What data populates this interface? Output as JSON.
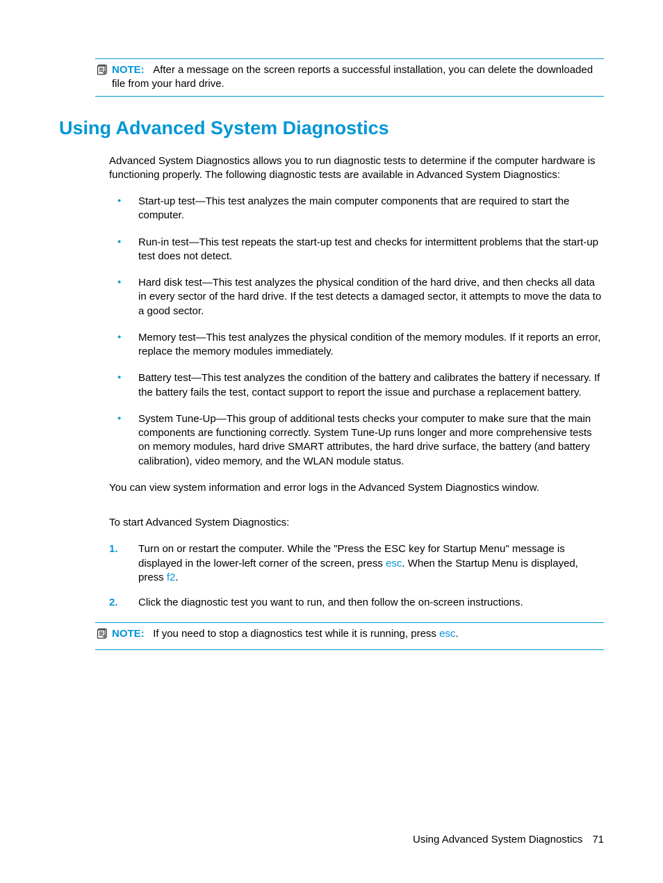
{
  "note1": {
    "label": "NOTE:",
    "text": "After a message on the screen reports a successful installation, you can delete the downloaded file from your hard drive."
  },
  "heading": "Using Advanced System Diagnostics",
  "intro": "Advanced System Diagnostics allows you to run diagnostic tests to determine if the computer hardware is functioning properly. The following diagnostic tests are available in Advanced System Diagnostics:",
  "bullets": [
    "Start-up test—This test analyzes the main computer components that are required to start the computer.",
    "Run-in test—This test repeats the start-up test and checks for intermittent problems that the start-up test does not detect.",
    "Hard disk test—This test analyzes the physical condition of the hard drive, and then checks all data in every sector of the hard drive. If the test detects a damaged sector, it attempts to move the data to a good sector.",
    "Memory test—This test analyzes the physical condition of the memory modules. If it reports an error, replace the memory modules immediately.",
    "Battery test—This test analyzes the condition of the battery and calibrates the battery if necessary. If the battery fails the test, contact support to report the issue and purchase a replacement battery.",
    "System Tune-Up—This group of additional tests checks your computer to make sure that the main components are functioning correctly. System Tune-Up runs longer and more comprehensive tests on memory modules, hard drive SMART attributes, the hard drive surface, the battery (and battery calibration), video memory, and the WLAN module status."
  ],
  "para_view": "You can view system information and error logs in the Advanced System Diagnostics window.",
  "para_start": "To start Advanced System Diagnostics:",
  "steps": {
    "s1": {
      "num": "1.",
      "pre": "Turn on or restart the computer. While the \"Press the ESC key for Startup Menu\" message is displayed in the lower-left corner of the screen, press ",
      "key1": "esc",
      "mid": ". When the Startup Menu is displayed, press ",
      "key2": "f2",
      "post": "."
    },
    "s2": {
      "num": "2.",
      "text": "Click the diagnostic test you want to run, and then follow the on-screen instructions."
    }
  },
  "note2": {
    "label": "NOTE:",
    "pre": "If you need to stop a diagnostics test while it is running, press ",
    "key": "esc",
    "post": "."
  },
  "footer": {
    "title": "Using Advanced System Diagnostics",
    "page": "71"
  }
}
